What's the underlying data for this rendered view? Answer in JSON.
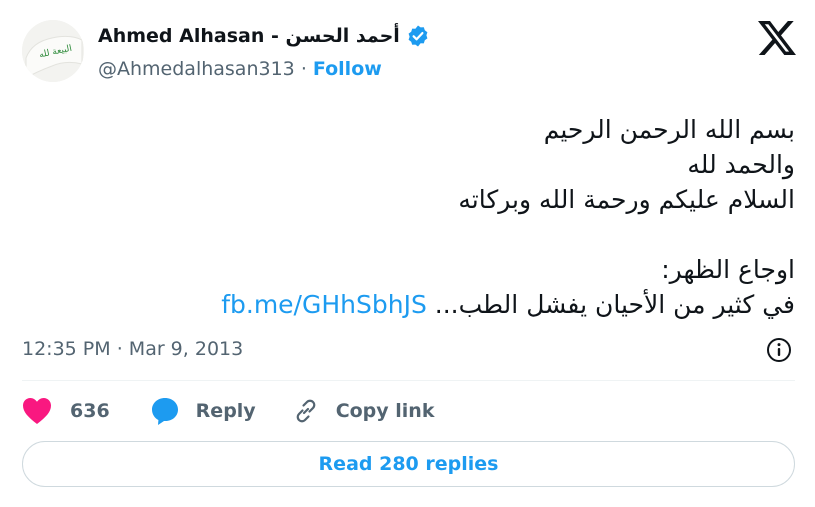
{
  "author": {
    "name": "Ahmed Alhasan - أحمد الحسن",
    "handle": "@Ahmedalhasan313",
    "separator": "·",
    "follow_label": "Follow",
    "avatar_flag_text": "البيعة لله"
  },
  "tweet": {
    "lines": [
      "بسم الله الرحمن الرحيم",
      "والحمد لله",
      "السلام عليكم ورحمة الله وبركاته",
      "",
      "اوجاع الظهر:"
    ],
    "last_line_text": "في كثير من الأحيان يفشل الطب...",
    "link": "fb.me/GHhSbhJS"
  },
  "meta": {
    "time": "12:35 PM",
    "separator": "·",
    "date": "Mar 9, 2013"
  },
  "actions": {
    "like_count": "636",
    "reply_label": "Reply",
    "copy_link_label": "Copy link"
  },
  "read_replies_label": "Read 280 replies",
  "colors": {
    "accent": "#1d9bf0",
    "like": "#f91880",
    "text": "#0f1419",
    "muted": "#536471",
    "border": "#cfd9de",
    "avatar_flag_bg": "#f4f4f2",
    "avatar_flag_text": "#2e8b3a"
  },
  "icons": {
    "verified": "verified-badge-icon",
    "brand": "x-logo-icon",
    "info": "info-icon",
    "like": "heart-icon",
    "reply": "speech-bubble-icon",
    "copy": "link-icon"
  }
}
